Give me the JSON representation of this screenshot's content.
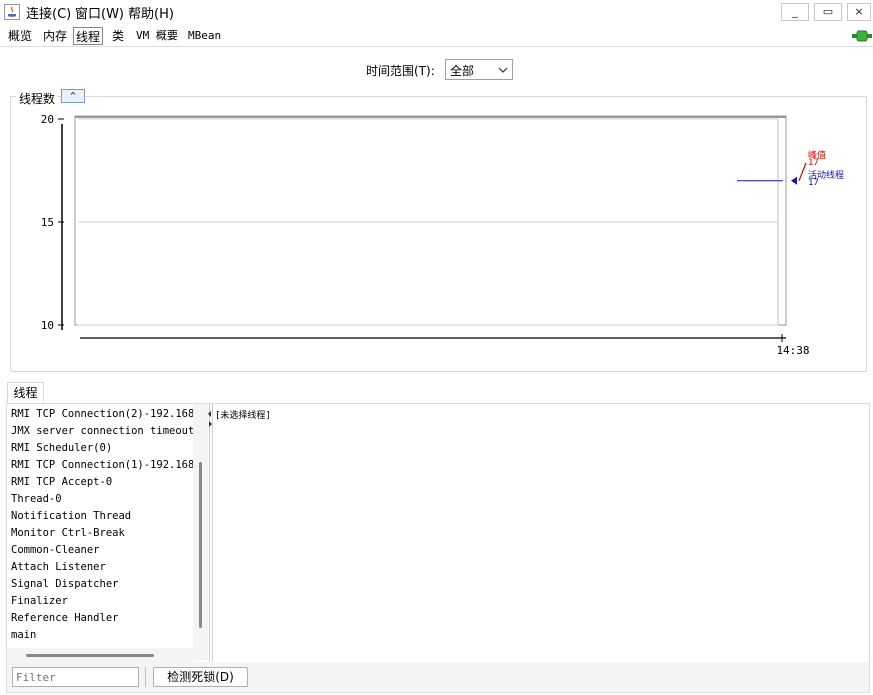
{
  "menubar": {
    "items": [
      "连接(C)",
      "窗口(W)",
      "帮助(H)"
    ],
    "minimize": "_",
    "restore": "▭",
    "close": "×"
  },
  "tabs": [
    "概览",
    "内存",
    "线程",
    "类",
    "VM 概要",
    "MBean"
  ],
  "selected_tab": "线程",
  "time_range": {
    "label": "时间范围(T):",
    "value": "全部"
  },
  "thread_count_panel": {
    "title": "线程数",
    "collapse_glyph": "⌃"
  },
  "chart_data": {
    "type": "line",
    "y_ticks": [
      "20",
      "15",
      "10"
    ],
    "ylim": [
      10,
      20
    ],
    "x_ticks": [
      "14:38"
    ],
    "series": [
      {
        "name": "峰值",
        "value_label": "17",
        "color": "#e00000",
        "values": [
          17
        ]
      },
      {
        "name": "活动线程",
        "value_label": "17",
        "color": "#1414a0",
        "values": [
          17
        ]
      }
    ]
  },
  "threads_panel": {
    "tab_label": "线程",
    "items": [
      "RMI TCP Connection(2)-192.168.",
      "JMX server connection timeout",
      "RMI Scheduler(0)",
      "RMI TCP Connection(1)-192.168.",
      "RMI TCP Accept-0",
      "Thread-0",
      "Notification Thread",
      "Monitor Ctrl-Break",
      "Common-Cleaner",
      "Attach Listener",
      "Signal Dispatcher",
      "Finalizer",
      "Reference Handler",
      "main"
    ],
    "detail_text": "[未选择线程]",
    "filter_placeholder": "Filter",
    "detect_deadlock": "检测死锁(D)"
  }
}
